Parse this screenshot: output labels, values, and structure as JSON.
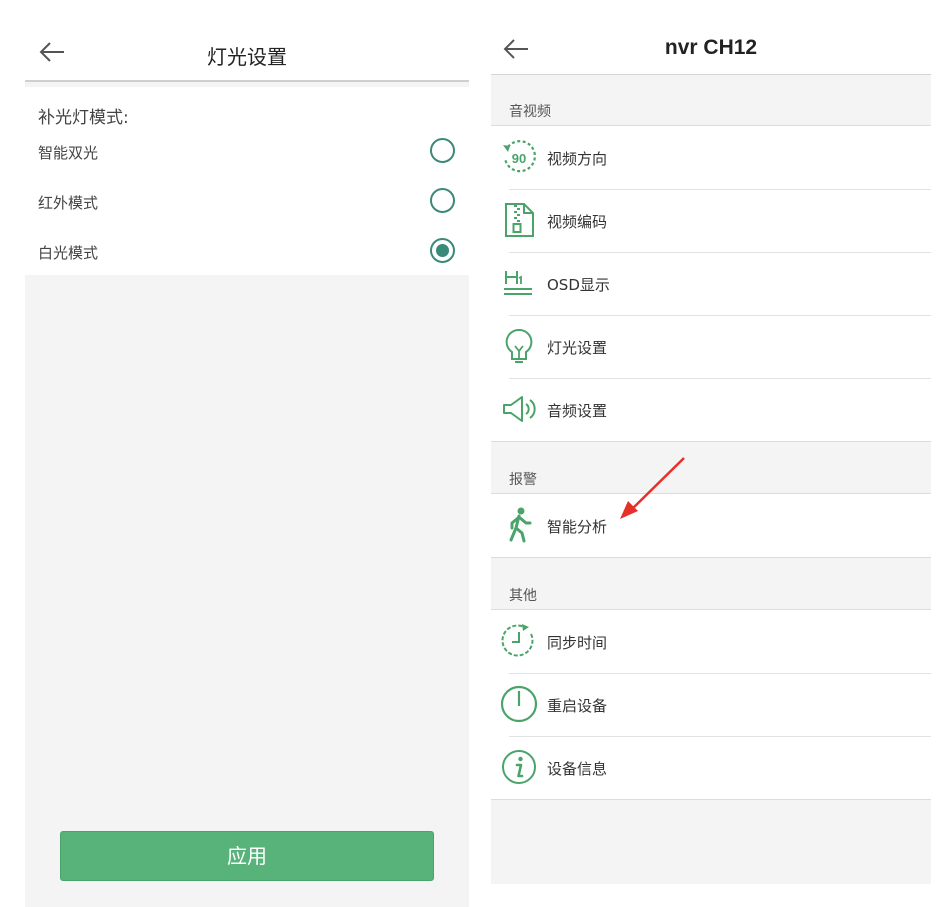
{
  "left": {
    "title": "灯光设置",
    "mode_label": "补光灯模式:",
    "options": [
      {
        "label": "智能双光",
        "selected": false
      },
      {
        "label": "红外模式",
        "selected": false
      },
      {
        "label": "白光模式",
        "selected": true
      }
    ],
    "apply_label": "应用"
  },
  "right": {
    "title": "nvr CH12",
    "sections": [
      {
        "header": "音视频",
        "items": [
          {
            "label": "视频方向",
            "icon": "rotate-90-icon"
          },
          {
            "label": "视频编码",
            "icon": "zip-file-icon"
          },
          {
            "label": "OSD显示",
            "icon": "heading-icon"
          },
          {
            "label": "灯光设置",
            "icon": "lightbulb-icon"
          },
          {
            "label": "音频设置",
            "icon": "speaker-icon"
          }
        ]
      },
      {
        "header": "报警",
        "items": [
          {
            "label": "智能分析",
            "icon": "walking-person-icon"
          }
        ]
      },
      {
        "header": "其他",
        "items": [
          {
            "label": "同步时间",
            "icon": "clock-sync-icon"
          },
          {
            "label": "重启设备",
            "icon": "power-icon"
          },
          {
            "label": "设备信息",
            "icon": "info-icon"
          }
        ]
      }
    ],
    "icon_number": "90"
  },
  "colors": {
    "accent_green": "#58b37a",
    "radio_teal": "#3a8a7a",
    "annotation_red": "#e8302a"
  }
}
